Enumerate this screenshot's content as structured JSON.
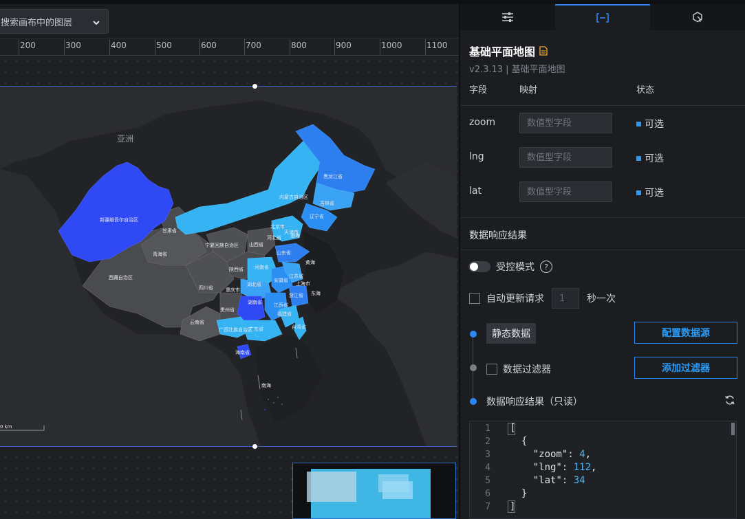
{
  "search": {
    "text": "搜索画布中的图层"
  },
  "ruler": {
    "ticks": [
      "200",
      "300",
      "400",
      "500",
      "600",
      "700",
      "800",
      "900",
      "1000",
      "1100"
    ]
  },
  "map": {
    "continent_label": "亚洲",
    "scale_label": "0 km",
    "province_labels": [
      "新疆维吾尔自治区",
      "西藏自治区",
      "青海省",
      "甘肃省",
      "内蒙古自治区",
      "黑龙江省",
      "吉林省",
      "辽宁省",
      "北京市",
      "天津市",
      "河北省",
      "山西省",
      "宁夏回族自治区",
      "陕西省",
      "山东省",
      "河南省",
      "四川省",
      "重庆市",
      "湖北省",
      "安徽省",
      "江苏省",
      "上海市",
      "浙江省",
      "湖南省",
      "江西省",
      "福建省",
      "贵州省",
      "云南省",
      "广西壮族自治区",
      "广东省",
      "台湾省",
      "海南省",
      "黄海",
      "东海",
      "南海",
      "渤海"
    ]
  },
  "panel": {
    "tabs": [
      {
        "name": "settings",
        "icon": "sliders-icon"
      },
      {
        "name": "data",
        "icon": "data-bracket-icon"
      },
      {
        "name": "interaction",
        "icon": "interaction-icon"
      }
    ],
    "title": "基础平面地图",
    "version": "v2.3.13 | 基础平面地图",
    "table_head": {
      "field": "字段",
      "mapping": "映射",
      "status": "状态"
    },
    "fields": [
      {
        "name": "zoom",
        "placeholder": "数值型字段",
        "status": "可选"
      },
      {
        "name": "lng",
        "placeholder": "数值型字段",
        "status": "可选"
      },
      {
        "name": "lat",
        "placeholder": "数值型字段",
        "status": "可选"
      }
    ],
    "section_title": "数据响应结果",
    "controlled_mode": "受控模式",
    "auto_update": {
      "label": "自动更新请求",
      "value": "1",
      "suffix": "秒一次"
    },
    "static_data": "静态数据",
    "configure_source": "配置数据源",
    "data_filter": "数据过滤器",
    "add_filter": "添加过滤器",
    "result_readonly": "数据响应结果（只读）",
    "code_lines": [
      "[",
      "  {",
      "    \"zoom\": 4,",
      "    \"lng\": 112,",
      "    \"lat\": 34",
      "  }",
      "]"
    ],
    "line_numbers": [
      "1",
      "2",
      "3",
      "4",
      "5",
      "6",
      "7"
    ],
    "accent_color": "#2b87f5"
  }
}
